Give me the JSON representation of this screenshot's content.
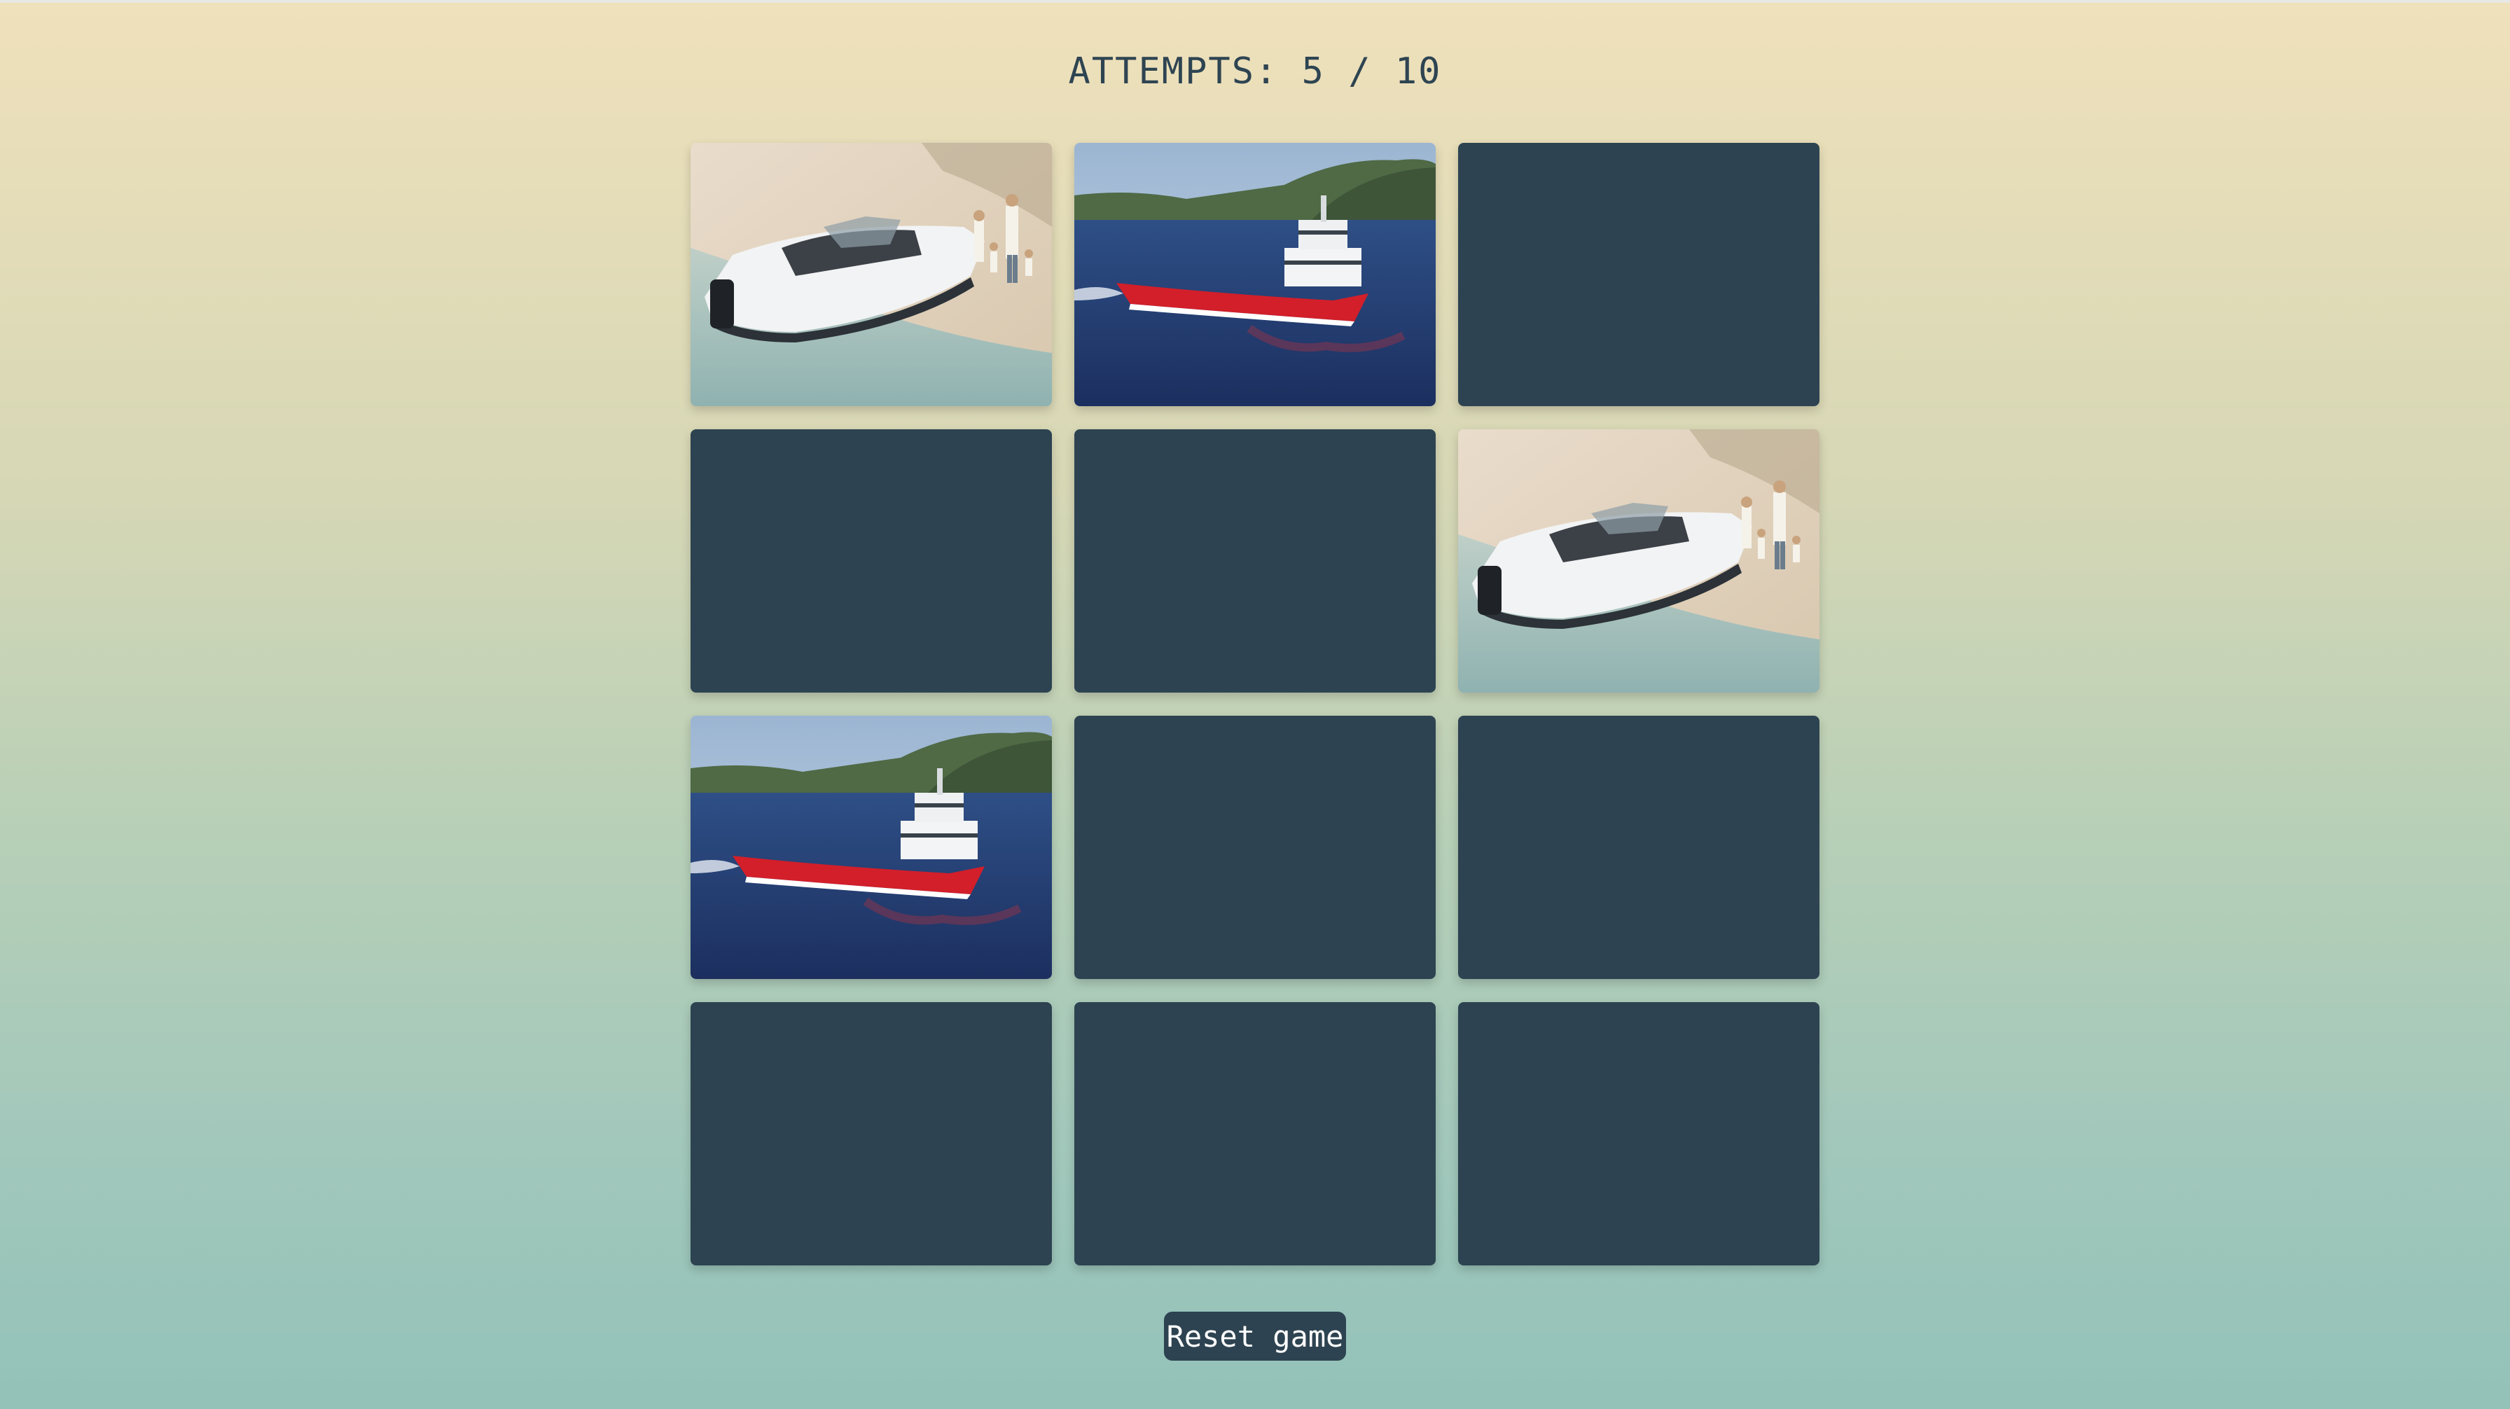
{
  "game": {
    "attempts_text": "ATTEMPTS: 5 / 10",
    "attempts_used": 5,
    "attempts_max": 10
  },
  "board": {
    "rows": 4,
    "columns": 3,
    "cards": [
      {
        "state": "face-up",
        "image": "speedboat-beach-family"
      },
      {
        "state": "face-up",
        "image": "red-ship-fjord"
      },
      {
        "state": "face-down",
        "image": ""
      },
      {
        "state": "face-down",
        "image": ""
      },
      {
        "state": "face-down",
        "image": ""
      },
      {
        "state": "face-up",
        "image": "speedboat-beach-family"
      },
      {
        "state": "face-up",
        "image": "red-ship-fjord"
      },
      {
        "state": "face-down",
        "image": ""
      },
      {
        "state": "face-down",
        "image": ""
      },
      {
        "state": "face-down",
        "image": ""
      },
      {
        "state": "face-down",
        "image": ""
      },
      {
        "state": "face-down",
        "image": ""
      }
    ]
  },
  "controls": {
    "reset_label": "Reset game"
  },
  "colors": {
    "card_back": "#2d4351",
    "text": "#2e4452",
    "button_bg": "#2d4351",
    "button_text": "#ffffff"
  }
}
